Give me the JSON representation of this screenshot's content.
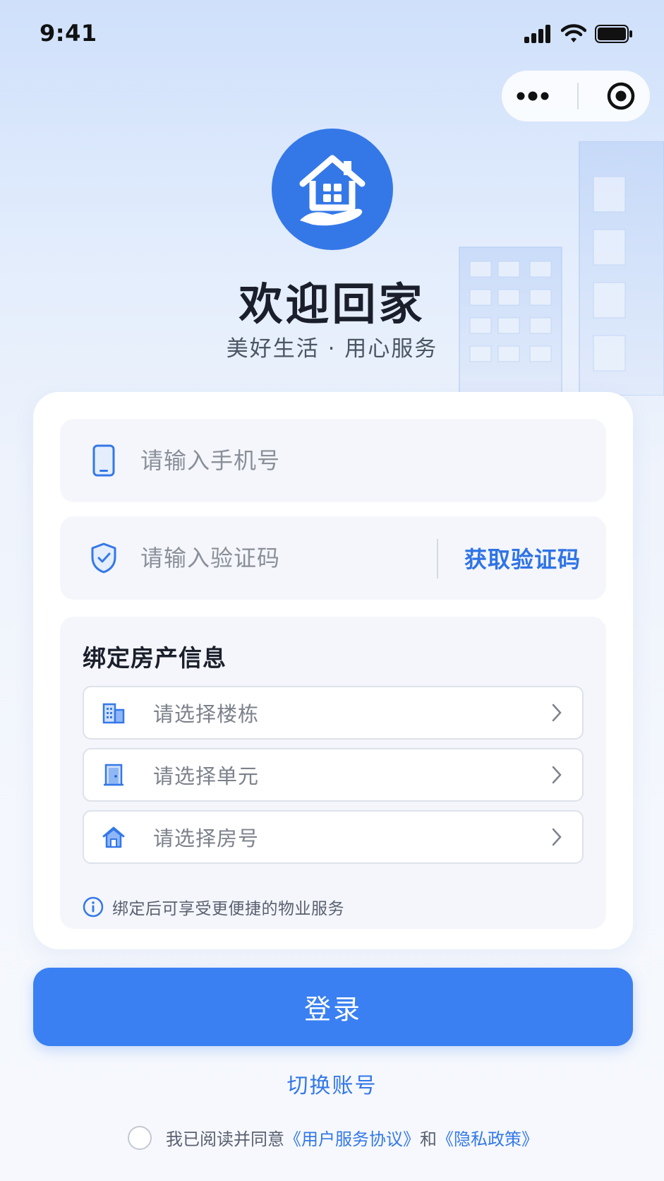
{
  "status_bar": {
    "time": "9:41"
  },
  "capsule": {
    "more_icon": "more-dots-icon",
    "close_icon": "target-icon"
  },
  "header": {
    "title": "欢迎回家",
    "subtitle": "美好生活 · 用心服务"
  },
  "login_form": {
    "phone_placeholder": "请输入手机号",
    "code_placeholder": "请输入验证码",
    "get_code_label": "获取验证码"
  },
  "binding": {
    "title": "绑定房产信息",
    "selects": [
      {
        "label": "请选择楼栋",
        "icon": "building-icon"
      },
      {
        "label": "请选择单元",
        "icon": "door-icon"
      },
      {
        "label": "请选择房号",
        "icon": "house-icon"
      }
    ],
    "hint": "绑定后可享受更便捷的物业服务"
  },
  "actions": {
    "login_label": "登录",
    "switch_account_label": "切换账号"
  },
  "agreement": {
    "prefix": "我已阅读并同意",
    "terms_link": "《用户服务协议》",
    "and": "和",
    "privacy_link": "《隐私政策》"
  },
  "colors": {
    "primary": "#3478e8",
    "button": "#3a80f2",
    "field_bg": "#f4f6fb"
  }
}
